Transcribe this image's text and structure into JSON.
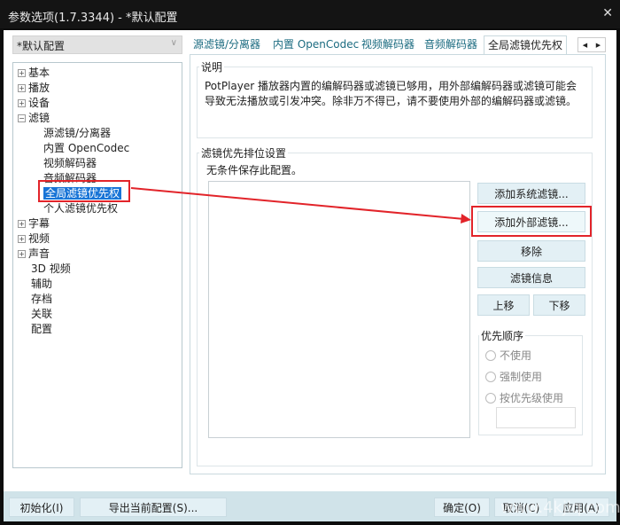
{
  "window": {
    "title": "参数选项(1.7.3344) - *默认配置",
    "close": "✕"
  },
  "profile": {
    "selected": "*默认配置"
  },
  "tree": [
    {
      "label": "基本",
      "expander": "+"
    },
    {
      "label": "播放",
      "expander": "+"
    },
    {
      "label": "设备",
      "expander": "+"
    },
    {
      "label": "滤镜",
      "expander": "−"
    },
    {
      "label": "源滤镜/分离器",
      "child": true
    },
    {
      "label": "内置 OpenCodec",
      "child": true
    },
    {
      "label": "视频解码器",
      "child": true
    },
    {
      "label": "音频解码器",
      "child": true
    },
    {
      "label": "全局滤镜优先权",
      "child": true,
      "selected": true
    },
    {
      "label": "个人滤镜优先权",
      "child": true
    },
    {
      "label": "字幕",
      "expander": "+"
    },
    {
      "label": "视频",
      "expander": "+"
    },
    {
      "label": "声音",
      "expander": "+"
    },
    {
      "label": "3D 视频"
    },
    {
      "label": "辅助"
    },
    {
      "label": "存档"
    },
    {
      "label": "关联"
    },
    {
      "label": "配置"
    }
  ],
  "tabs": [
    "源滤镜/分离器",
    "内置 OpenCodec",
    "视频解码器",
    "音频解码器",
    "全局滤镜优先权"
  ],
  "active_tab": 4,
  "description": {
    "title": "说明",
    "text": "PotPlayer 播放器内置的编解码器或滤镜已够用，用外部编解码器或滤镜可能会导致无法播放或引发冲突。除非万不得已，请不要使用外部的编解码器或滤镜。"
  },
  "priority": {
    "title": "滤镜优先排位设置",
    "note": "无条件保存此配置。",
    "buttons": {
      "add_system": "添加系统滤镜...",
      "add_external": "添加外部滤镜...",
      "remove": "移除",
      "info": "滤镜信息",
      "up": "上移",
      "down": "下移"
    },
    "order": {
      "title": "优先顺序",
      "options": [
        "不使用",
        "强制使用",
        "按优先级使用"
      ],
      "value": ""
    }
  },
  "footer": {
    "init": "初始化(I)",
    "export": "导出当前配置(S)...",
    "ok": "确定(O)",
    "cancel": "取消(C)",
    "apply": "应用(A)"
  },
  "watermark": "www.4kjiq.com",
  "colors": {
    "selection": "#1874d6",
    "annotation": "#e2242a",
    "titlebar": "#141414",
    "footer": "#d0e3e9"
  }
}
